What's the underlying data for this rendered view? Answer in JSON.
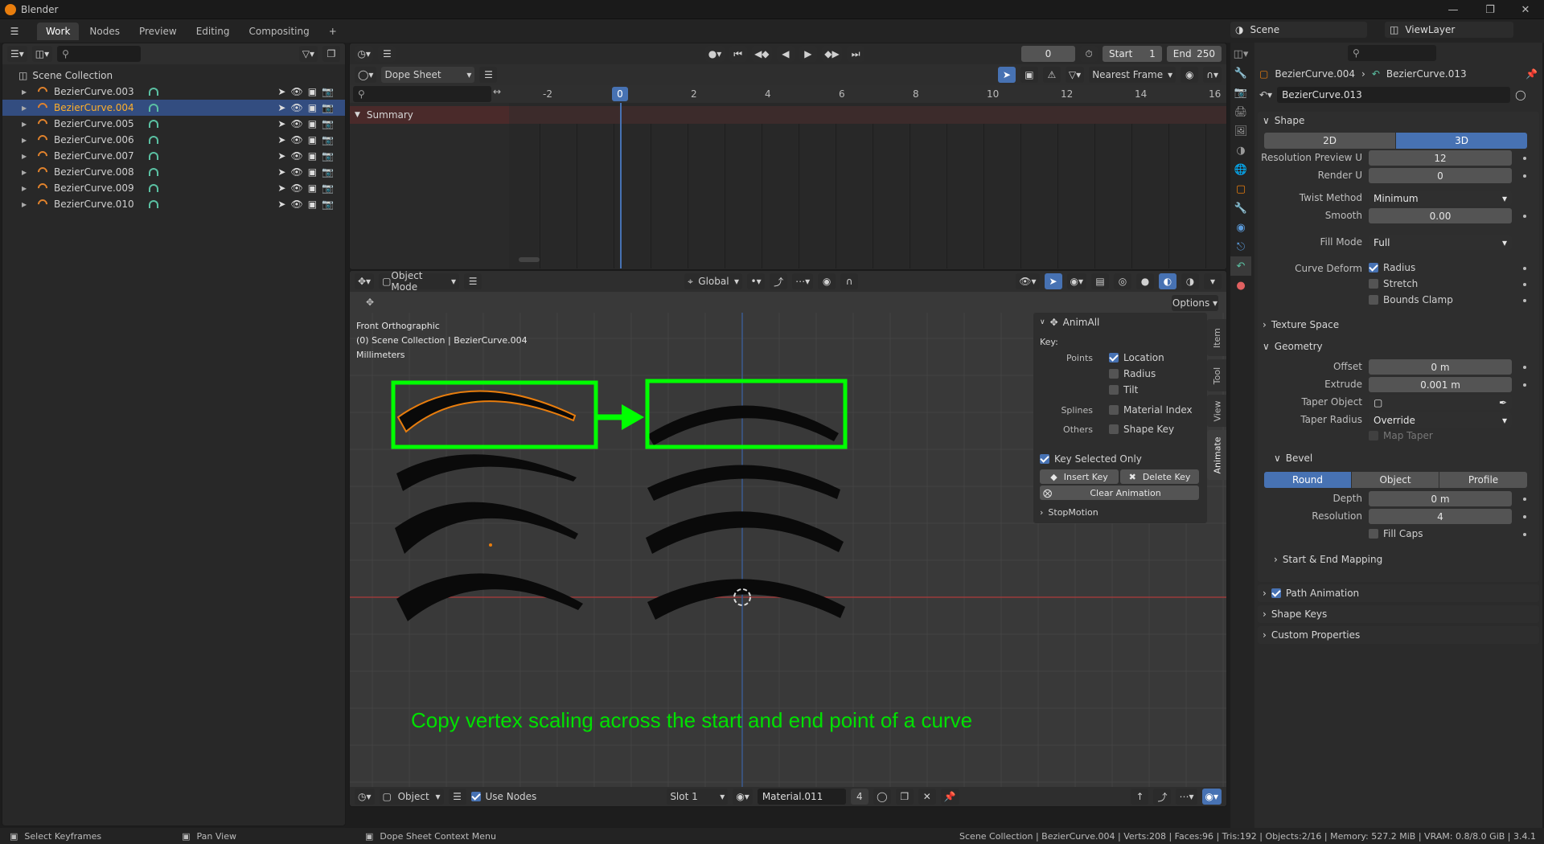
{
  "app": {
    "title": "Blender",
    "version": "3.4.1"
  },
  "colors": {
    "accent": "#4772b3",
    "selected_orange": "#ffaf29",
    "overlay_green": "#00ff00",
    "playhead": "#4772b3",
    "summary_bg": "#4a2a2a"
  },
  "workspaces": [
    "Work",
    "Nodes",
    "Preview",
    "Editing",
    "Compositing"
  ],
  "workspace_add": "+",
  "scene": {
    "name": "Scene",
    "view_layer": "ViewLayer"
  },
  "outliner": {
    "root": "Scene Collection",
    "items": [
      {
        "name": "BezierCurve.003",
        "selected": false
      },
      {
        "name": "BezierCurve.004",
        "selected": true
      },
      {
        "name": "BezierCurve.005",
        "selected": false
      },
      {
        "name": "BezierCurve.006",
        "selected": false
      },
      {
        "name": "BezierCurve.007",
        "selected": false
      },
      {
        "name": "BezierCurve.008",
        "selected": false
      },
      {
        "name": "BezierCurve.009",
        "selected": false
      },
      {
        "name": "BezierCurve.010",
        "selected": false
      }
    ]
  },
  "timeline": {
    "current_frame": "0",
    "start_label": "Start",
    "start": "1",
    "end_label": "End",
    "end": "250"
  },
  "dopesheet": {
    "mode": "Dope Sheet",
    "snap": "Nearest Frame",
    "summary": "Summary",
    "frame_ticks": [
      "-2",
      "0",
      "2",
      "4",
      "6",
      "8",
      "10",
      "12",
      "14",
      "16"
    ],
    "playhead": "0"
  },
  "viewport": {
    "mode": "Object Mode",
    "orientation": "Global",
    "options": "Options",
    "info": [
      "Front Orthographic",
      "(0) Scene Collection | BezierCurve.004",
      "Millimeters"
    ],
    "caption": "Copy vertex scaling across the start and end point of a curve",
    "side_tabs": [
      "Item",
      "Tool",
      "View",
      "Animate"
    ]
  },
  "animall": {
    "title": "AnimAll",
    "key_label": "Key:",
    "points_label": "Points",
    "location": "Location",
    "radius": "Radius",
    "tilt": "Tilt",
    "splines_label": "Splines",
    "material_index": "Material Index",
    "others_label": "Others",
    "shape_key": "Shape Key",
    "key_selected_only": "Key Selected Only",
    "insert_key": "Insert Key",
    "delete_key": "Delete Key",
    "clear_animation": "Clear Animation",
    "stopmotion": "StopMotion"
  },
  "shader_bar": {
    "editor": "Object",
    "use_nodes": "Use Nodes",
    "slot": "Slot 1",
    "material": "Material.011",
    "users": "4"
  },
  "properties": {
    "breadcrumb_obj": "BezierCurve.004",
    "breadcrumb_data": "BezierCurve.013",
    "datablock": "BezierCurve.013",
    "shape": "Shape",
    "dim_2d": "2D",
    "dim_3d": "3D",
    "res_preview_label": "Resolution Preview U",
    "res_preview": "12",
    "render_u_label": "Render U",
    "render_u": "0",
    "twist_label": "Twist Method",
    "twist": "Minimum",
    "smooth_label": "Smooth",
    "smooth": "0.00",
    "fill_label": "Fill Mode",
    "fill": "Full",
    "curve_deform_label": "Curve Deform",
    "cd_radius": "Radius",
    "cd_stretch": "Stretch",
    "cd_bounds": "Bounds Clamp",
    "texture_space": "Texture Space",
    "geometry": "Geometry",
    "offset_label": "Offset",
    "offset": "0 m",
    "extrude_label": "Extrude",
    "extrude": "0.001 m",
    "taper_obj_label": "Taper Object",
    "taper_radius_label": "Taper Radius",
    "taper_radius": "Override",
    "map_taper": "Map Taper",
    "bevel": "Bevel",
    "bevel_round": "Round",
    "bevel_object": "Object",
    "bevel_profile": "Profile",
    "depth_label": "Depth",
    "depth": "0 m",
    "resolution_label": "Resolution",
    "resolution": "4",
    "fill_caps": "Fill Caps",
    "start_end": "Start & End Mapping",
    "path_anim": "Path Animation",
    "shape_keys": "Shape Keys",
    "custom_props": "Custom Properties"
  },
  "status": {
    "left1": "Select Keyframes",
    "left2": "Pan View",
    "mid": "Dope Sheet Context Menu",
    "right": "Scene Collection | BezierCurve.004 | Verts:208 | Faces:96 | Tris:192 | Objects:2/16 | Memory: 527.2 MiB | VRAM: 0.8/8.0 GiB | 3.4.1"
  }
}
